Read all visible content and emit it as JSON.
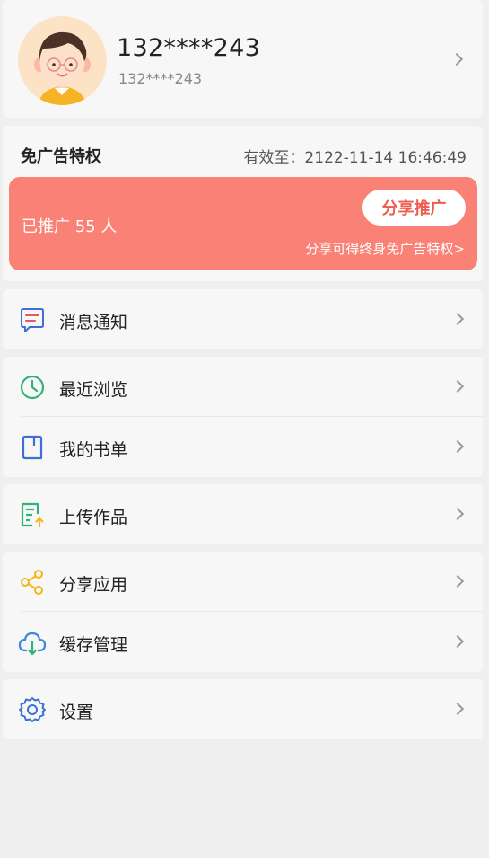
{
  "profile": {
    "name": "132****243",
    "account": "132****243"
  },
  "vip": {
    "title": "免广告特权",
    "valid_until": "有效至：2122-11-14 16:46:49",
    "promo_count": "已推广 55 人",
    "share_button": "分享推广",
    "share_hint": "分享可得终身免广告特权>"
  },
  "menu": {
    "messages": "消息通知",
    "history": "最近浏览",
    "booklist": "我的书单",
    "upload": "上传作品",
    "share_app": "分享应用",
    "cache": "缓存管理",
    "settings": "设置"
  },
  "colors": {
    "promo_bg": "#fa8176",
    "share_text": "#ef5c4e",
    "page_bg": "#efefef",
    "card_bg": "#f7f7f7"
  }
}
